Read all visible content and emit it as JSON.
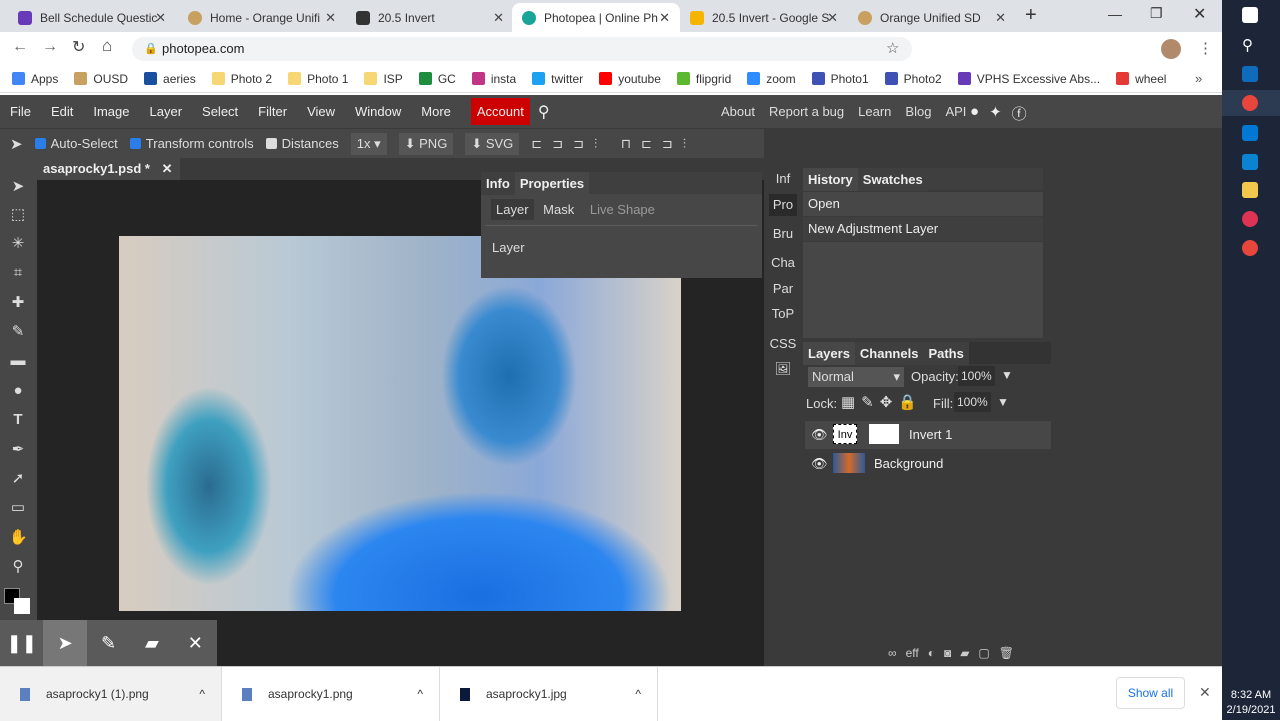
{
  "browser": {
    "tabs": [
      {
        "title": "Bell Schedule Questic",
        "color": "#673ab7"
      },
      {
        "title": "Home - Orange Unifi",
        "color": "#c8a060"
      },
      {
        "title": "20.5 Invert",
        "color": "#333333"
      },
      {
        "title": "Photopea | Online Ph",
        "color": "#18a497"
      },
      {
        "title": "20.5 Invert - Google S",
        "color": "#f4b400"
      },
      {
        "title": "Orange Unified SD",
        "color": "#c8a060"
      }
    ],
    "new_tab": "+",
    "url": "photopea.com",
    "bookmarks": [
      {
        "label": "Apps",
        "color": "#4285f4"
      },
      {
        "label": "OUSD",
        "color": "#c8a060"
      },
      {
        "label": "aeries",
        "color": "#1a4fa0"
      },
      {
        "label": "Photo 2",
        "color": "#f7d774"
      },
      {
        "label": "Photo 1",
        "color": "#f7d774"
      },
      {
        "label": "ISP",
        "color": "#f7d774"
      },
      {
        "label": "GC",
        "color": "#1e8e3e"
      },
      {
        "label": "insta",
        "color": "#c13584"
      },
      {
        "label": "twitter",
        "color": "#1da1f2"
      },
      {
        "label": "youtube",
        "color": "#ff0000"
      },
      {
        "label": "flipgrid",
        "color": "#5cb82e"
      },
      {
        "label": "zoom",
        "color": "#2d8cff"
      },
      {
        "label": "Photo1",
        "color": "#3f51b5"
      },
      {
        "label": "Photo2",
        "color": "#3f51b5"
      },
      {
        "label": "VPHS Excessive Abs...",
        "color": "#673ab7"
      },
      {
        "label": "wheel",
        "color": "#e53935"
      }
    ],
    "more_bookmarks": "»"
  },
  "photopea": {
    "menu": [
      "File",
      "Edit",
      "Image",
      "Layer",
      "Select",
      "Filter",
      "View",
      "Window",
      "More"
    ],
    "account": "Account",
    "right_menu": [
      "About",
      "Report a bug",
      "Learn",
      "Blog",
      "API"
    ],
    "options": {
      "auto_select": "Auto-Select",
      "transform": "Transform controls",
      "distances": "Distances",
      "scale": "1x",
      "png": "PNG",
      "svg": "SVG"
    },
    "doc_tab": "asaprocky1.psd *",
    "properties": {
      "tabs": [
        "Info",
        "Properties"
      ],
      "subtabs": [
        "Layer",
        "Mask",
        "Live Shape"
      ],
      "content": "Layer"
    },
    "narrow": [
      "Inf",
      "Pro",
      "Bru",
      "Cha",
      "Par",
      "ToP",
      "CSS"
    ],
    "history": {
      "tabs": [
        "History",
        "Swatches"
      ],
      "items": [
        "Open",
        "New Adjustment Layer"
      ]
    },
    "layers": {
      "tabs": [
        "Layers",
        "Channels",
        "Paths"
      ],
      "blend": "Normal",
      "opacity_label": "Opacity:",
      "opacity": "100%",
      "lock_label": "Lock:",
      "fill_label": "Fill:",
      "fill": "100%",
      "items": [
        {
          "name": "Invert 1",
          "thumb": "Inv"
        },
        {
          "name": "Background"
        }
      ],
      "footer": "eff"
    }
  },
  "downloads": {
    "items": [
      "asaprocky1 (1).png",
      "asaprocky1.png",
      "asaprocky1.jpg"
    ],
    "show_all": "Show all"
  },
  "clock": {
    "time": "8:32 AM",
    "date": "2/19/2021"
  }
}
